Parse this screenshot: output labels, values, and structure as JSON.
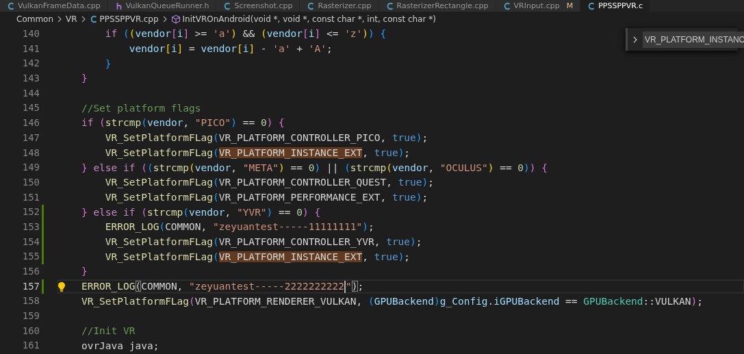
{
  "tabs": [
    {
      "label": "VulkanFrameData.cpp",
      "kind": "cpp",
      "selected": false
    },
    {
      "label": "VulkanQueueRunner.h",
      "kind": "h",
      "selected": false
    },
    {
      "label": "Screenshot.cpp",
      "kind": "cpp",
      "selected": false
    },
    {
      "label": "Rasterizer.cpp",
      "kind": "cpp",
      "selected": false
    },
    {
      "label": "RasterizerRectangle.cpp",
      "kind": "cpp",
      "selected": false
    },
    {
      "label": "VRInput.cpp",
      "kind": "cpp",
      "badge": "M",
      "selected": false
    },
    {
      "label": "PPSSPPVR.c",
      "kind": "cpp",
      "selected": true
    }
  ],
  "breadcrumb": [
    {
      "text": "Common",
      "kind": "folder"
    },
    {
      "text": "VR",
      "kind": "folder"
    },
    {
      "text": "PPSSPPVR.cpp",
      "kind": "file"
    },
    {
      "text": "InitVROnAndroid(void *, void *, const char *, int, const char *)",
      "kind": "symbol"
    }
  ],
  "find_widget": {
    "query": "VR_PLATFORM_INSTANC"
  },
  "lines": [
    {
      "number": "140",
      "modified": false,
      "current": false,
      "bulb": false,
      "tokens": [
        {
          "kind": "kw",
          "text": "        if"
        },
        {
          "kind": "b3",
          "text": " ("
        },
        {
          "kind": "b1",
          "text": "("
        },
        {
          "kind": "var",
          "text": "vendor"
        },
        {
          "kind": "b2",
          "text": "["
        },
        {
          "kind": "var",
          "text": "i"
        },
        {
          "kind": "b2",
          "text": "]"
        },
        {
          "kind": "op",
          "text": " >= "
        },
        {
          "kind": "str",
          "text": "'a'"
        },
        {
          "kind": "b1",
          "text": ")"
        },
        {
          "kind": "op",
          "text": " && "
        },
        {
          "kind": "b1",
          "text": "("
        },
        {
          "kind": "var",
          "text": "vendor"
        },
        {
          "kind": "b2",
          "text": "["
        },
        {
          "kind": "var",
          "text": "i"
        },
        {
          "kind": "b2",
          "text": "]"
        },
        {
          "kind": "op",
          "text": " <= "
        },
        {
          "kind": "str",
          "text": "'z'"
        },
        {
          "kind": "b1",
          "text": ")"
        },
        {
          "kind": "b3",
          "text": ")"
        },
        {
          "kind": "b3",
          "text": " {"
        }
      ]
    },
    {
      "number": "141",
      "modified": false,
      "current": false,
      "bulb": false,
      "tokens": [
        {
          "kind": "var",
          "text": "            vendor"
        },
        {
          "kind": "b1",
          "text": "["
        },
        {
          "kind": "var",
          "text": "i"
        },
        {
          "kind": "b1",
          "text": "]"
        },
        {
          "kind": "op",
          "text": " = "
        },
        {
          "kind": "var",
          "text": "vendor"
        },
        {
          "kind": "b1",
          "text": "["
        },
        {
          "kind": "var",
          "text": "i"
        },
        {
          "kind": "b1",
          "text": "]"
        },
        {
          "kind": "op",
          "text": " - "
        },
        {
          "kind": "str",
          "text": "'a'"
        },
        {
          "kind": "op",
          "text": " + "
        },
        {
          "kind": "str",
          "text": "'A'"
        },
        {
          "kind": "op",
          "text": ";"
        }
      ]
    },
    {
      "number": "142",
      "modified": false,
      "current": false,
      "bulb": false,
      "tokens": [
        {
          "kind": "b3",
          "text": "        }"
        }
      ]
    },
    {
      "number": "143",
      "modified": false,
      "current": false,
      "bulb": false,
      "tokens": [
        {
          "kind": "b2",
          "text": "    }"
        }
      ]
    },
    {
      "number": "144",
      "modified": false,
      "current": false,
      "bulb": false
    },
    {
      "number": "145",
      "modified": false,
      "current": false,
      "bulb": false,
      "tokens": [
        {
          "kind": "cmt",
          "text": "    //Set platform flags"
        }
      ]
    },
    {
      "number": "146",
      "modified": false,
      "current": false,
      "bulb": false,
      "tokens": [
        {
          "kind": "kw",
          "text": "    if"
        },
        {
          "kind": "b2",
          "text": " ("
        },
        {
          "kind": "fn",
          "text": "strcmp"
        },
        {
          "kind": "b3",
          "text": "("
        },
        {
          "kind": "var",
          "text": "vendor"
        },
        {
          "kind": "op",
          "text": ", "
        },
        {
          "kind": "str",
          "text": "\"PICO\""
        },
        {
          "kind": "b3",
          "text": ")"
        },
        {
          "kind": "op",
          "text": " == "
        },
        {
          "kind": "num",
          "text": "0"
        },
        {
          "kind": "b2",
          "text": ")"
        },
        {
          "kind": "b2",
          "text": " {"
        }
      ]
    },
    {
      "number": "147",
      "modified": false,
      "current": false,
      "bulb": false,
      "tokens": [
        {
          "kind": "fn",
          "text": "        VR_SetPlatformFLag"
        },
        {
          "kind": "b3",
          "text": "("
        },
        {
          "kind": "op",
          "text": "VR_PLATFORM_CONTROLLER_PICO, "
        },
        {
          "kind": "const",
          "text": "true"
        },
        {
          "kind": "b3",
          "text": ")"
        },
        {
          "kind": "op",
          "text": ";"
        }
      ]
    },
    {
      "number": "148",
      "modified": false,
      "current": false,
      "bulb": false,
      "tokens": [
        {
          "kind": "fn",
          "text": "        VR_SetPlatformFLag"
        },
        {
          "kind": "b3",
          "text": "("
        },
        {
          "kind": "match",
          "text": "VR_PLATFORM_INSTANCE_EXT"
        },
        {
          "kind": "op",
          "text": ", "
        },
        {
          "kind": "const",
          "text": "true"
        },
        {
          "kind": "b3",
          "text": ")"
        },
        {
          "kind": "op",
          "text": ";"
        }
      ]
    },
    {
      "number": "149",
      "modified": false,
      "current": false,
      "bulb": false,
      "tokens": [
        {
          "kind": "b2",
          "text": "    }"
        },
        {
          "kind": "kw",
          "text": " else if"
        },
        {
          "kind": "b2",
          "text": " ("
        },
        {
          "kind": "b3",
          "text": "("
        },
        {
          "kind": "fn",
          "text": "strcmp"
        },
        {
          "kind": "b1",
          "text": "("
        },
        {
          "kind": "var",
          "text": "vendor"
        },
        {
          "kind": "op",
          "text": ", "
        },
        {
          "kind": "str",
          "text": "\"META\""
        },
        {
          "kind": "b1",
          "text": ")"
        },
        {
          "kind": "op",
          "text": " == "
        },
        {
          "kind": "num",
          "text": "0"
        },
        {
          "kind": "b3",
          "text": ")"
        },
        {
          "kind": "op",
          "text": " || "
        },
        {
          "kind": "b3",
          "text": "("
        },
        {
          "kind": "fn",
          "text": "strcmp"
        },
        {
          "kind": "b1",
          "text": "("
        },
        {
          "kind": "var",
          "text": "vendor"
        },
        {
          "kind": "op",
          "text": ", "
        },
        {
          "kind": "str",
          "text": "\"OCULUS\""
        },
        {
          "kind": "b1",
          "text": ")"
        },
        {
          "kind": "op",
          "text": " == "
        },
        {
          "kind": "num",
          "text": "0"
        },
        {
          "kind": "b3",
          "text": ")"
        },
        {
          "kind": "b2",
          "text": ")"
        },
        {
          "kind": "b2",
          "text": " {"
        }
      ]
    },
    {
      "number": "150",
      "modified": false,
      "current": false,
      "bulb": false,
      "tokens": [
        {
          "kind": "fn",
          "text": "        VR_SetPlatformFLag"
        },
        {
          "kind": "b3",
          "text": "("
        },
        {
          "kind": "op",
          "text": "VR_PLATFORM_CONTROLLER_QUEST, "
        },
        {
          "kind": "const",
          "text": "true"
        },
        {
          "kind": "b3",
          "text": ")"
        },
        {
          "kind": "op",
          "text": ";"
        }
      ]
    },
    {
      "number": "151",
      "modified": false,
      "current": false,
      "bulb": false,
      "tokens": [
        {
          "kind": "fn",
          "text": "        VR_SetPlatformFLag"
        },
        {
          "kind": "b3",
          "text": "("
        },
        {
          "kind": "op",
          "text": "VR_PLATFORM_PERFORMANCE_EXT, "
        },
        {
          "kind": "const",
          "text": "true"
        },
        {
          "kind": "b3",
          "text": ")"
        },
        {
          "kind": "op",
          "text": ";"
        }
      ]
    },
    {
      "number": "152",
      "modified": true,
      "current": false,
      "bulb": false,
      "tokens": [
        {
          "kind": "b2",
          "text": "    }"
        },
        {
          "kind": "kw",
          "text": " else if"
        },
        {
          "kind": "b2",
          "text": " ("
        },
        {
          "kind": "fn",
          "text": "strcmp"
        },
        {
          "kind": "b3",
          "text": "("
        },
        {
          "kind": "var",
          "text": "vendor"
        },
        {
          "kind": "op",
          "text": ", "
        },
        {
          "kind": "str",
          "text": "\"YVR\""
        },
        {
          "kind": "b3",
          "text": ")"
        },
        {
          "kind": "op",
          "text": " == "
        },
        {
          "kind": "num",
          "text": "0"
        },
        {
          "kind": "b2",
          "text": ")"
        },
        {
          "kind": "b2",
          "text": " {"
        }
      ]
    },
    {
      "number": "153",
      "modified": true,
      "current": false,
      "bulb": false,
      "tokens": [
        {
          "kind": "fn",
          "text": "        ERROR_LOG"
        },
        {
          "kind": "b3",
          "text": "("
        },
        {
          "kind": "op",
          "text": "COMMON, "
        },
        {
          "kind": "str",
          "text": "\"zeyuantest-----11111111\""
        },
        {
          "kind": "b3",
          "text": ")"
        },
        {
          "kind": "op",
          "text": ";"
        }
      ]
    },
    {
      "number": "154",
      "modified": true,
      "current": false,
      "bulb": false,
      "tokens": [
        {
          "kind": "fn",
          "text": "        VR_SetPlatformFLag"
        },
        {
          "kind": "b3",
          "text": "("
        },
        {
          "kind": "op",
          "text": "VR_PLATFORM_CONTROLLER_YVR, "
        },
        {
          "kind": "const",
          "text": "true"
        },
        {
          "kind": "b3",
          "text": ")"
        },
        {
          "kind": "op",
          "text": ";"
        }
      ]
    },
    {
      "number": "155",
      "modified": true,
      "current": false,
      "bulb": false,
      "tokens": [
        {
          "kind": "fn",
          "text": "        VR_SetPlatformFLag"
        },
        {
          "kind": "b3",
          "text": "("
        },
        {
          "kind": "match",
          "text": "VR_PLATFORM_INSTANCE_EXT"
        },
        {
          "kind": "op",
          "text": ", "
        },
        {
          "kind": "const",
          "text": "true"
        },
        {
          "kind": "b3",
          "text": ")"
        },
        {
          "kind": "op",
          "text": ";"
        }
      ]
    },
    {
      "number": "156",
      "modified": false,
      "current": false,
      "bulb": false,
      "tokens": [
        {
          "kind": "b2",
          "text": "    }"
        }
      ]
    },
    {
      "number": "157",
      "modified": true,
      "current": true,
      "bulb": true,
      "tokens": [
        {
          "kind": "fn",
          "text": "    ERROR_LOG"
        },
        {
          "kind": "bmatch",
          "text": "("
        },
        {
          "kind": "op",
          "text": "COMMON, "
        },
        {
          "kind": "str_caret",
          "text": "\"zeyuantest-----2222222222"
        },
        {
          "kind": "str",
          "text": "\""
        },
        {
          "kind": "bmatch",
          "text": ")"
        },
        {
          "kind": "op",
          "text": ";"
        }
      ]
    },
    {
      "number": "158",
      "modified": false,
      "current": false,
      "bulb": false,
      "tokens": [
        {
          "kind": "fn",
          "text": "    VR_SetPlatformFLag"
        },
        {
          "kind": "b2",
          "text": "("
        },
        {
          "kind": "op",
          "text": "VR_PLATFORM_RENDERER_VULKAN, "
        },
        {
          "kind": "b3",
          "text": "("
        },
        {
          "kind": "var",
          "text": "GPUBackend"
        },
        {
          "kind": "b3",
          "text": ")"
        },
        {
          "kind": "var",
          "text": "g_Config"
        },
        {
          "kind": "op",
          "text": "."
        },
        {
          "kind": "var",
          "text": "iGPUBackend"
        },
        {
          "kind": "op",
          "text": " == "
        },
        {
          "kind": "type",
          "text": "GPUBackend"
        },
        {
          "kind": "op",
          "text": "::VULKAN"
        },
        {
          "kind": "b2",
          "text": ")"
        },
        {
          "kind": "op",
          "text": ";"
        }
      ]
    },
    {
      "number": "159",
      "modified": false,
      "current": false,
      "bulb": false
    },
    {
      "number": "160",
      "modified": false,
      "current": false,
      "bulb": false,
      "tokens": [
        {
          "kind": "cmt",
          "text": "    //Init VR"
        }
      ]
    },
    {
      "number": "161",
      "modified": false,
      "current": false,
      "bulb": false,
      "tokens": [
        {
          "kind": "op",
          "text": "    ovrJava java;"
        }
      ]
    }
  ]
}
